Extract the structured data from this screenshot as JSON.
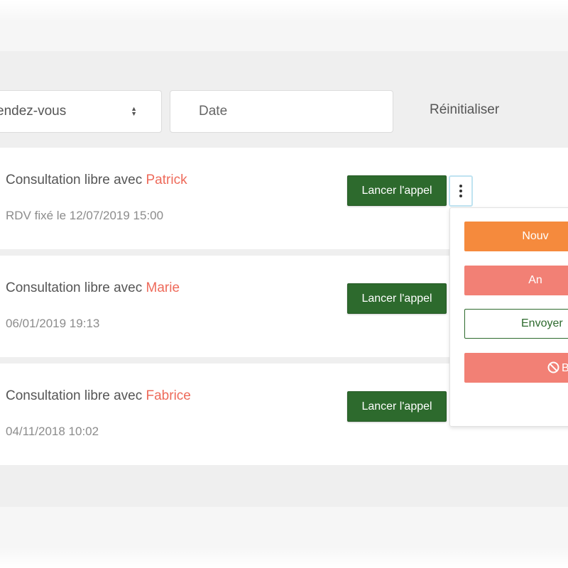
{
  "filters": {
    "select_value": "endez-vous",
    "date_placeholder": "Date",
    "reset_label": "Réinitialiser"
  },
  "appointments": [
    {
      "title": "Consultation libre avec ",
      "name": "Patrick",
      "meta": "RDV fixé le 12/07/2019 15:00",
      "call_label": "Lancer l'appel"
    },
    {
      "title": "Consultation libre avec ",
      "name": "Marie",
      "meta": "06/01/2019 19:13",
      "call_label": "Lancer l'appel"
    },
    {
      "title": "Consultation libre avec ",
      "name": "Fabrice",
      "meta": "04/11/2018 10:02",
      "call_label": "Lancer l'appel"
    }
  ],
  "dropdown": {
    "new_label": "Nouv",
    "cancel_label": "An",
    "send_label": "Envoyer",
    "block_label": "B",
    "block_icon": "ban-icon"
  },
  "colors": {
    "call_green": "#2d6a2d",
    "name_red": "#ee6a5a",
    "orange": "#f58a3d",
    "salmon": "#f28075"
  }
}
